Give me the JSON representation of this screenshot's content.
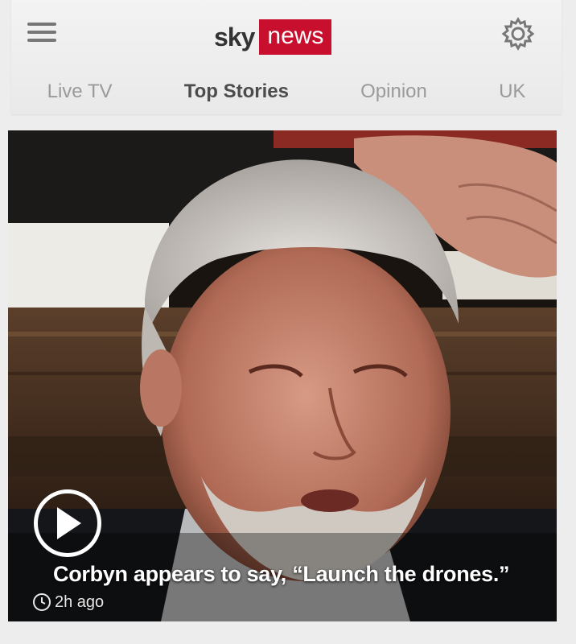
{
  "header": {
    "logo_sky": "sky",
    "logo_news": "news",
    "menu_icon": "hamburger-menu-icon",
    "settings_icon": "gear-icon"
  },
  "tabs": [
    {
      "label": "Live TV",
      "active": false
    },
    {
      "label": "Top Stories",
      "active": true
    },
    {
      "label": "Opinion",
      "active": false
    },
    {
      "label": "UK",
      "active": false
    }
  ],
  "story": {
    "headline": "Corbyn appears to say, “Launch the drones.”",
    "time": "2h ago",
    "play_icon": "play-icon",
    "clock_icon": "clock-icon"
  },
  "colors": {
    "brand_red": "#c8102e",
    "header_bg": "#eeeeee",
    "tab_inactive": "#9a9a9a",
    "tab_active": "#4c4c4c"
  }
}
